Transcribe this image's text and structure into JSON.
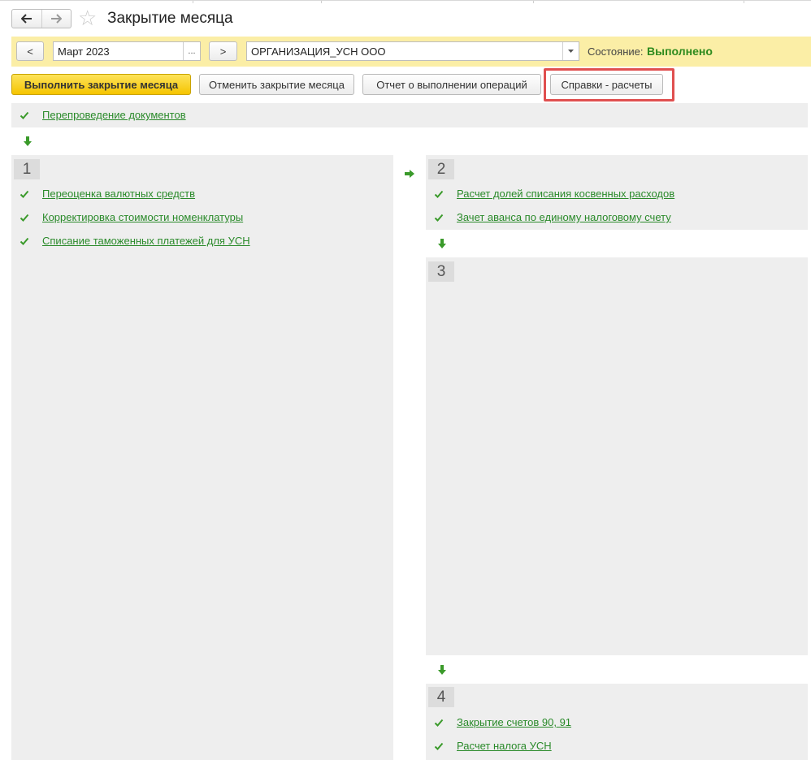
{
  "window": {
    "title": "Закрытие месяца",
    "nav_back_icon": "arrow-left-icon",
    "nav_forward_icon": "arrow-right-icon",
    "favorite_icon": "star-icon"
  },
  "toolbar": {
    "prev_label": "<",
    "period_value": "Март 2023",
    "period_select_label": "...",
    "next_label": ">",
    "organization_value": "ОРГАНИЗАЦИЯ_УСН ООО",
    "state_label": "Состояние:",
    "state_value": "Выполнено"
  },
  "actions": {
    "execute_label": "Выполнить закрытие месяца",
    "cancel_label": "Отменить закрытие месяца",
    "report_label": "Отчет о выполнении операций",
    "references_label": "Справки - расчеты"
  },
  "steps": {
    "repost": {
      "label": "Перепроведение документов"
    },
    "stage1": {
      "number": "1",
      "items": [
        {
          "label": "Переоценка валютных средств"
        },
        {
          "label": "Корректировка стоимости номенклатуры"
        },
        {
          "label": "Списание таможенных платежей для УСН"
        }
      ]
    },
    "stage2": {
      "number": "2",
      "items": [
        {
          "label": "Расчет долей списания косвенных расходов"
        },
        {
          "label": "Зачет аванса по единому налоговому счету"
        }
      ]
    },
    "stage3": {
      "number": "3"
    },
    "stage4": {
      "number": "4",
      "items": [
        {
          "label": "Закрытие счетов 90, 91"
        },
        {
          "label": "Расчет налога УСН"
        }
      ]
    }
  },
  "colors": {
    "accent_yellow": "#f5c400",
    "toolbar_bg": "#fbeea6",
    "done_green": "#2e8b1e",
    "highlight_red": "#e04f4f"
  }
}
